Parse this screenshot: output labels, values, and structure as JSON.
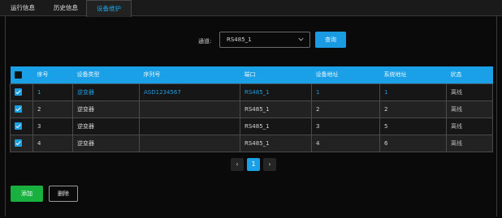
{
  "tabs": [
    {
      "label": "运行信息"
    },
    {
      "label": "历史信息"
    },
    {
      "label": "设备维护"
    }
  ],
  "filter": {
    "label": "通道:",
    "selected": "RS485_1",
    "query_label": "查询"
  },
  "table": {
    "headers": [
      "序号",
      "设备类型",
      "序列号",
      "端口",
      "设备地址",
      "系统地址",
      "状态"
    ],
    "rows": [
      {
        "index": "1",
        "type": "逆变器",
        "serial": "ASD1234567",
        "port": "RS485_1",
        "device_addr": "1",
        "system_addr": "1",
        "status": "离线"
      },
      {
        "index": "2",
        "type": "逆变器",
        "serial": "",
        "port": "RS485_1",
        "device_addr": "2",
        "system_addr": "2",
        "status": "离线"
      },
      {
        "index": "3",
        "type": "逆变器",
        "serial": "",
        "port": "RS485_1",
        "device_addr": "3",
        "system_addr": "5",
        "status": "离线"
      },
      {
        "index": "4",
        "type": "逆变器",
        "serial": "",
        "port": "RS485_1",
        "device_addr": "4",
        "system_addr": "6",
        "status": "离线"
      }
    ]
  },
  "pager": {
    "prev": "‹",
    "current": "1",
    "next": "›"
  },
  "actions": {
    "add_label": "添加",
    "delete_label": "删除"
  },
  "colors": {
    "accent": "#1aa0e6",
    "add": "#18b13f"
  }
}
